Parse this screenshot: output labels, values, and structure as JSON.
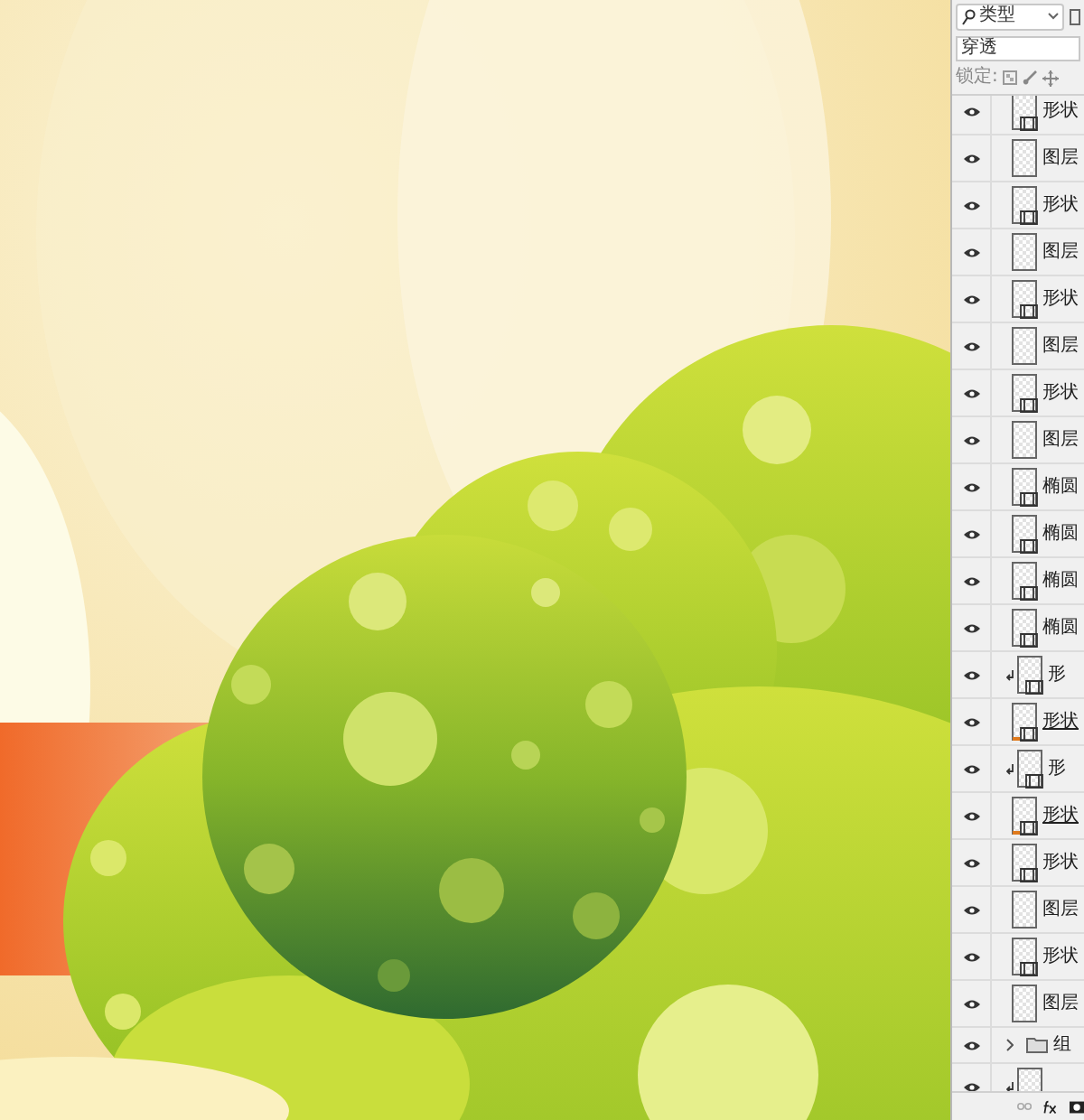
{
  "layers_panel": {
    "filter": {
      "value": "类型"
    },
    "blend_mode": {
      "value": "穿透"
    },
    "lock_label": "锁定:",
    "layers": [
      {
        "kind": "shape",
        "name": "形状",
        "clipped": false,
        "underlined": false
      },
      {
        "kind": "pixel",
        "name": "图层",
        "clipped": false,
        "underlined": false
      },
      {
        "kind": "shape",
        "name": "形状",
        "clipped": false,
        "underlined": false
      },
      {
        "kind": "pixel",
        "name": "图层",
        "clipped": false,
        "underlined": false
      },
      {
        "kind": "shape",
        "name": "形状",
        "clipped": false,
        "underlined": false
      },
      {
        "kind": "pixel",
        "name": "图层",
        "clipped": false,
        "underlined": false
      },
      {
        "kind": "shape",
        "name": "形状",
        "clipped": false,
        "underlined": false
      },
      {
        "kind": "pixel",
        "name": "图层",
        "clipped": false,
        "underlined": false
      },
      {
        "kind": "shape",
        "name": "椭圆",
        "clipped": false,
        "underlined": false
      },
      {
        "kind": "shape",
        "name": "椭圆",
        "clipped": false,
        "underlined": false
      },
      {
        "kind": "shape",
        "name": "椭圆",
        "clipped": false,
        "underlined": false
      },
      {
        "kind": "shape",
        "name": "椭圆",
        "clipped": false,
        "underlined": false
      },
      {
        "kind": "shape",
        "name": "形",
        "clipped": true,
        "underlined": false
      },
      {
        "kind": "shape",
        "name": "形状",
        "clipped": false,
        "underlined": true
      },
      {
        "kind": "shape",
        "name": "形",
        "clipped": true,
        "underlined": false
      },
      {
        "kind": "shape",
        "name": "形状",
        "clipped": false,
        "underlined": true
      },
      {
        "kind": "shape",
        "name": "形状",
        "clipped": false,
        "underlined": false
      },
      {
        "kind": "pixel",
        "name": "图层",
        "clipped": false,
        "underlined": false
      },
      {
        "kind": "shape",
        "name": "形状",
        "clipped": false,
        "underlined": false
      },
      {
        "kind": "pixel",
        "name": "图层",
        "clipped": false,
        "underlined": false
      },
      {
        "kind": "group",
        "name": "组",
        "clipped": false,
        "underlined": false
      },
      {
        "kind": "shape",
        "clipped": true,
        "underlined": false
      }
    ]
  }
}
